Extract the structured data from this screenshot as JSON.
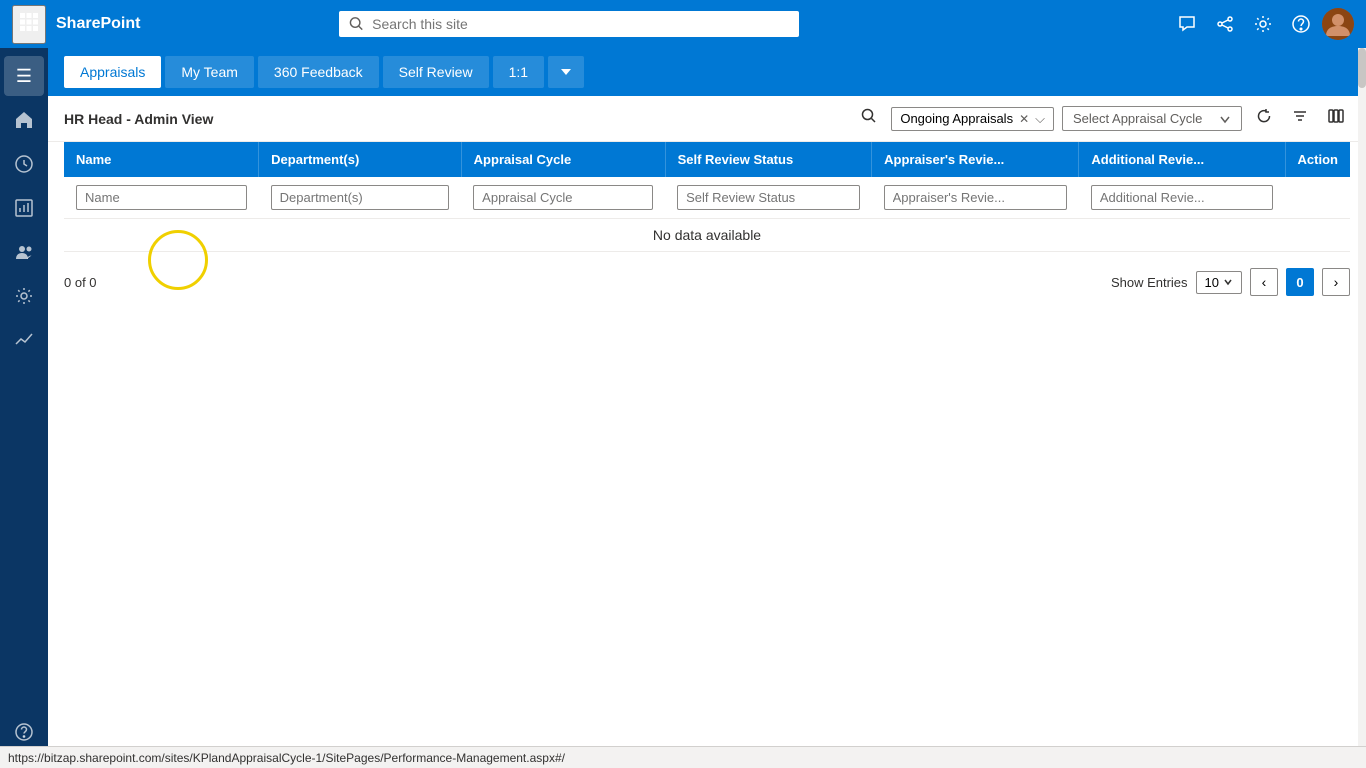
{
  "topNav": {
    "appName": "SharePoint",
    "searchPlaceholder": "Search this site",
    "icons": [
      "chat",
      "share",
      "settings",
      "help"
    ]
  },
  "sidebar": {
    "items": [
      {
        "name": "menu",
        "icon": "☰"
      },
      {
        "name": "home",
        "icon": "⌂"
      },
      {
        "name": "activity",
        "icon": "◈"
      },
      {
        "name": "reports",
        "icon": "📊"
      },
      {
        "name": "people",
        "icon": "👥"
      },
      {
        "name": "settings-gear",
        "icon": "⚙"
      },
      {
        "name": "analytics",
        "icon": "📈"
      }
    ],
    "bottomItems": [
      {
        "name": "help",
        "icon": "?"
      }
    ]
  },
  "tabs": [
    {
      "label": "Appraisals",
      "active": true
    },
    {
      "label": "My Team",
      "active": false
    },
    {
      "label": "360 Feedback",
      "active": false
    },
    {
      "label": "Self Review",
      "active": false
    },
    {
      "label": "1:1",
      "active": false
    },
    {
      "label": "▼",
      "active": false,
      "isIcon": true
    }
  ],
  "viewTitle": "HR Head - Admin View",
  "toolbar": {
    "filterTag": "Ongoing Appraisals",
    "selectCyclePlaceholder": "Select Appraisal Cycle"
  },
  "table": {
    "columns": [
      {
        "key": "name",
        "label": "Name",
        "filterValue": "Name"
      },
      {
        "key": "departments",
        "label": "Department(s)",
        "filterValue": "Department(s)"
      },
      {
        "key": "appraisalCycle",
        "label": "Appraisal Cycle",
        "filterValue": "Appraisal Cycle"
      },
      {
        "key": "selfReviewStatus",
        "label": "Self Review Status",
        "filterValue": "Self Review Status"
      },
      {
        "key": "appraiserReview",
        "label": "Appraiser's Revie...",
        "filterValue": "Appraiser's Revie..."
      },
      {
        "key": "additionalReview",
        "label": "Additional Revie...",
        "filterValue": "Additional Revie..."
      },
      {
        "key": "action",
        "label": "Action",
        "filterValue": ""
      }
    ],
    "rows": [],
    "noDataMessage": "No data available"
  },
  "pagination": {
    "recordsText": "0 of 0",
    "showEntriesLabel": "Show Entries",
    "entriesValue": "10",
    "currentPage": "0"
  },
  "statusBar": {
    "url": "https://bitzap.sharepoint.com/sites/KPlandAppraisalCycle-1/SitePages/Performance-Management.aspx#/"
  }
}
